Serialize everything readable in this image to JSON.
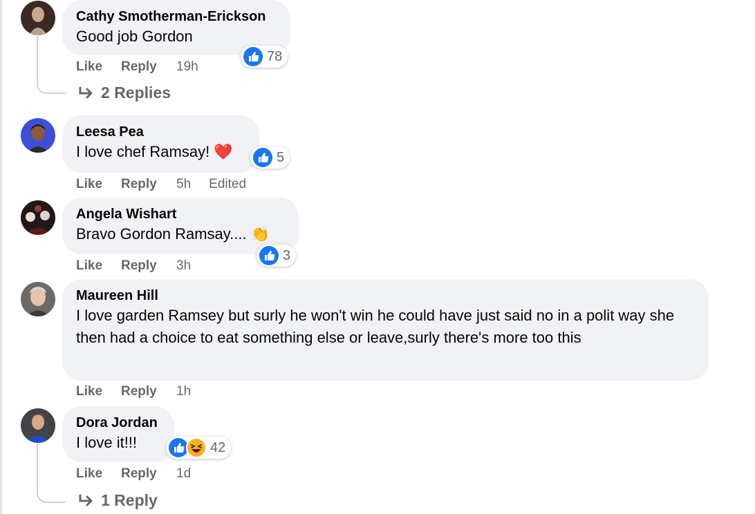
{
  "comments": [
    {
      "author": "Cathy Smotherman-Erickson",
      "text": "Good job Gordon",
      "actions": {
        "like": "Like",
        "reply": "Reply",
        "time": "19h",
        "edited": ""
      },
      "reactions": {
        "icons": [
          "like-icon"
        ],
        "count": "78"
      },
      "replies_label": "2 Replies"
    },
    {
      "author": "Leesa Pea",
      "text": "I love chef Ramsay! ❤️",
      "actions": {
        "like": "Like",
        "reply": "Reply",
        "time": "5h",
        "edited": "Edited"
      },
      "reactions": {
        "icons": [
          "like-icon"
        ],
        "count": "5"
      }
    },
    {
      "author": "Angela Wishart",
      "text": "Bravo Gordon Ramsay.... 👏",
      "actions": {
        "like": "Like",
        "reply": "Reply",
        "time": "3h",
        "edited": ""
      },
      "reactions": {
        "icons": [
          "like-icon"
        ],
        "count": "3"
      }
    },
    {
      "author": "Maureen Hill",
      "text": "I love garden Ramsey but surly he won't win he could have just said no in a polit way she then had a choice to eat something else or leave,surly there's more too this",
      "actions": {
        "like": "Like",
        "reply": "Reply",
        "time": "1h",
        "edited": ""
      }
    },
    {
      "author": "Dora Jordan",
      "text": "I love it!!!",
      "actions": {
        "like": "Like",
        "reply": "Reply",
        "time": "1d",
        "edited": ""
      },
      "reactions": {
        "icons": [
          "like-icon",
          "laugh-icon"
        ],
        "count": "42"
      },
      "replies_label": "1 Reply"
    }
  ],
  "colors": {
    "like_blue": "#1877f2",
    "bubble_bg": "#f0f2f5",
    "secondary_text": "#65676b",
    "heart_red": "#e0245e",
    "haha_yellow": "#f7b125"
  }
}
